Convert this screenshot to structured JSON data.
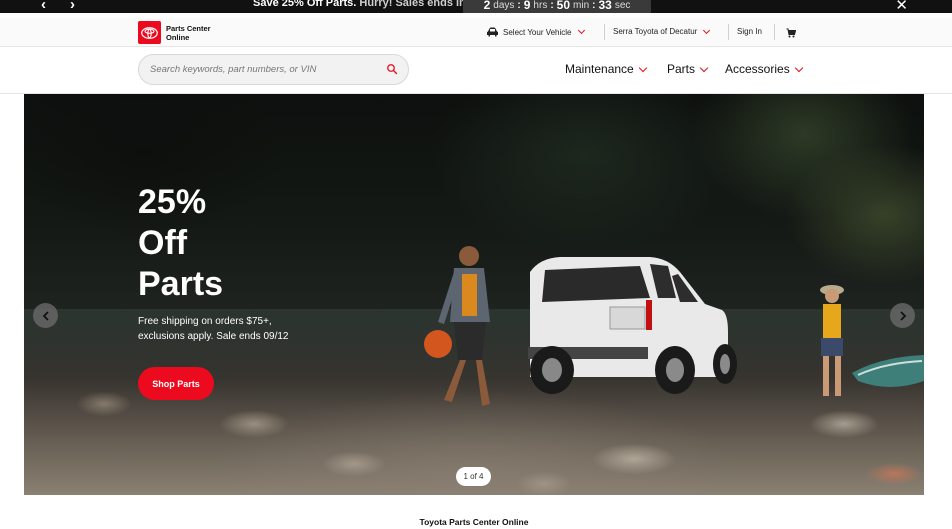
{
  "promo": {
    "bold_text": "Save 25% Off Parts.",
    "hurry_text": "Hurry! Sales ends in",
    "countdown": {
      "days_value": "2",
      "days_label": "days",
      "hours_value": "9",
      "hours_label": "hrs",
      "minutes_value": "50",
      "minutes_label": "min",
      "seconds_value": "33",
      "seconds_label": "sec"
    },
    "prev_icon": "chevron-left-icon",
    "next_icon": "chevron-right-icon",
    "close_icon": "close-icon"
  },
  "utility": {
    "logo_text_line1": "Parts Center",
    "logo_text_line2": "Online",
    "select_vehicle": "Select Your Vehicle",
    "dealer": "Serra Toyota of Decatur",
    "sign_in": "Sign In",
    "cart_icon": "cart-icon"
  },
  "header": {
    "search_placeholder": "Search keywords, part numbers, or VIN",
    "nav": [
      "Maintenance",
      "Parts",
      "Accessories"
    ]
  },
  "hero": {
    "title_line1": "25%",
    "title_line2": "Off",
    "title_line3": "Parts",
    "subtitle_line1": "Free shipping on orders $75+,",
    "subtitle_line2": "exclusions apply. Sale ends 09/12",
    "cta": "Shop Parts",
    "slide_indicator": "1 of 4"
  },
  "footer": {
    "title": "Toyota Parts Center Online"
  },
  "colors": {
    "brand_red": "#eb0a1e",
    "promo_bg": "#111111"
  }
}
